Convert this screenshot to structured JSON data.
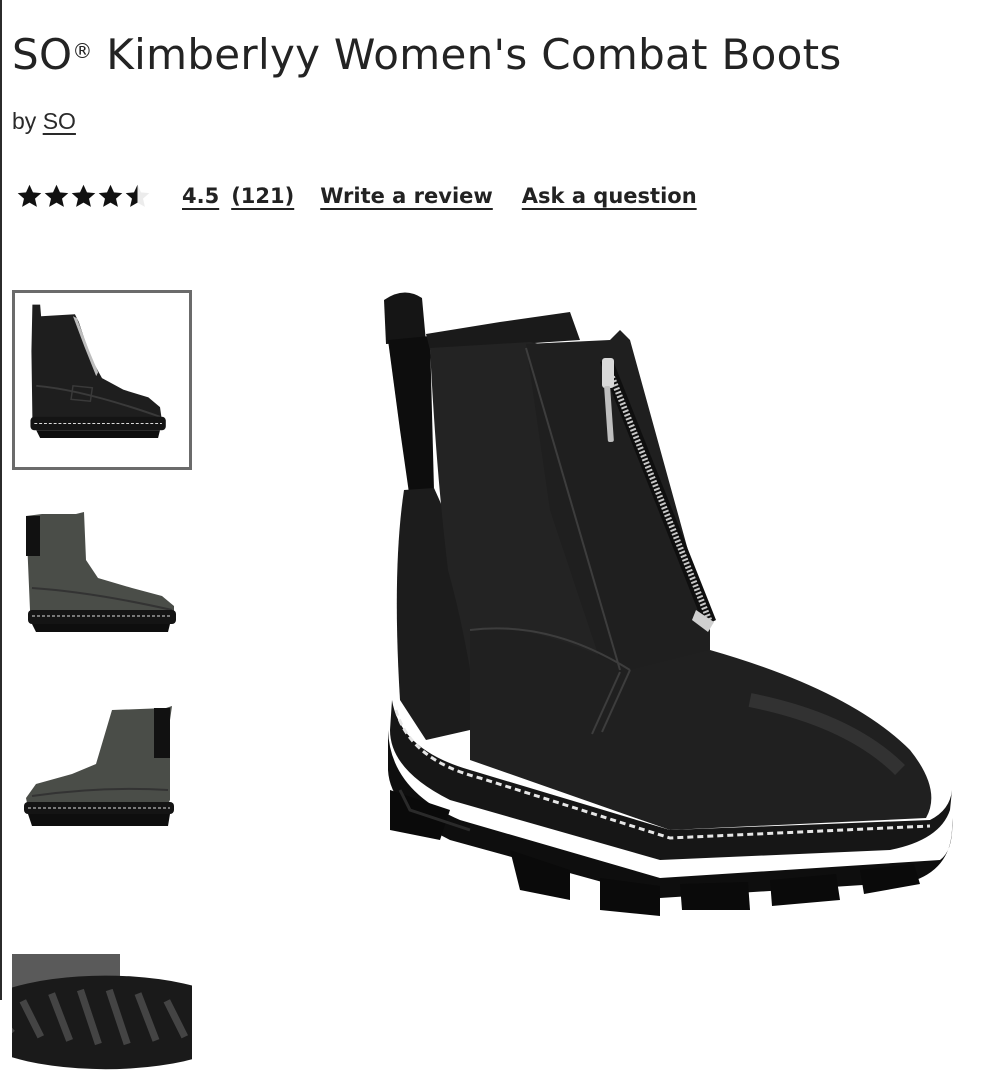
{
  "product": {
    "title_prefix": "SO",
    "title_registered": "®",
    "title_rest": " Kimberlyy Women's Combat Boots",
    "by_label": "by",
    "brand": "SO"
  },
  "rating": {
    "value": "4.5",
    "count": "(121)",
    "stars_filled": 4.5,
    "stars_total": 5,
    "write_review_label": "Write a review",
    "ask_question_label": "Ask a question"
  },
  "gallery": {
    "thumbnails": [
      {
        "view": "side view, black",
        "selected": true
      },
      {
        "view": "side view, grey",
        "selected": false
      },
      {
        "view": "rear side view, grey",
        "selected": false
      },
      {
        "view": "sole view",
        "selected": false
      }
    ],
    "main_view": "three-quarter view, black"
  },
  "colors": {
    "text": "#232323",
    "boot_black": "#1b1b1b",
    "boot_grey": "#4a4d48",
    "selected_border": "#6b6b6b"
  }
}
